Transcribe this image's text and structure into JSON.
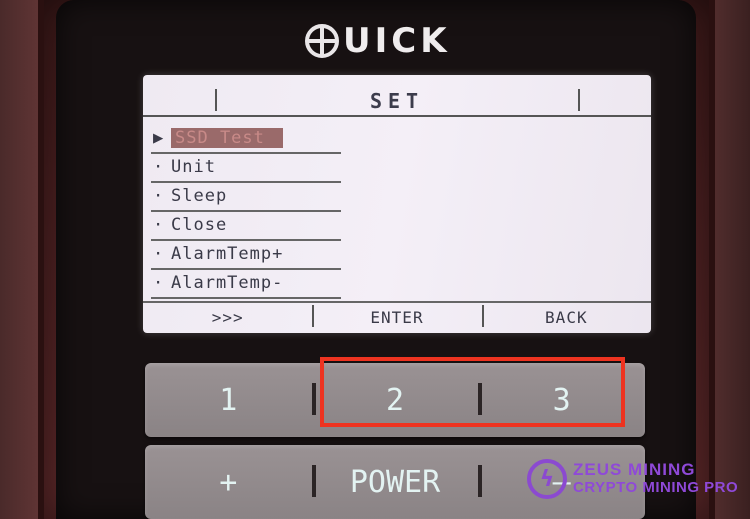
{
  "brand": {
    "logo_text": "UICK"
  },
  "screen": {
    "title": "SET",
    "menu": [
      {
        "bullet": "▶",
        "label": "SSD Test",
        "selected": true
      },
      {
        "bullet": "·",
        "label": "Unit",
        "selected": false
      },
      {
        "bullet": "·",
        "label": "Sleep",
        "selected": false
      },
      {
        "bullet": "·",
        "label": "Close",
        "selected": false
      },
      {
        "bullet": "·",
        "label": "AlarmTemp+",
        "selected": false
      },
      {
        "bullet": "·",
        "label": "AlarmTemp-",
        "selected": false
      }
    ],
    "softkeys": [
      ">>>",
      "ENTER",
      "BACK"
    ]
  },
  "keypad": {
    "row1": [
      "1",
      "2",
      "3"
    ],
    "row2": [
      "+",
      "POWER",
      "—"
    ]
  },
  "watermark": {
    "line1": "ZEUS MINING",
    "line2": "CRYPTO MINING PRO"
  },
  "colors": {
    "highlight": "#ee3320",
    "watermark": "#8f49d8",
    "screen_bg": "#f1ecf4"
  }
}
